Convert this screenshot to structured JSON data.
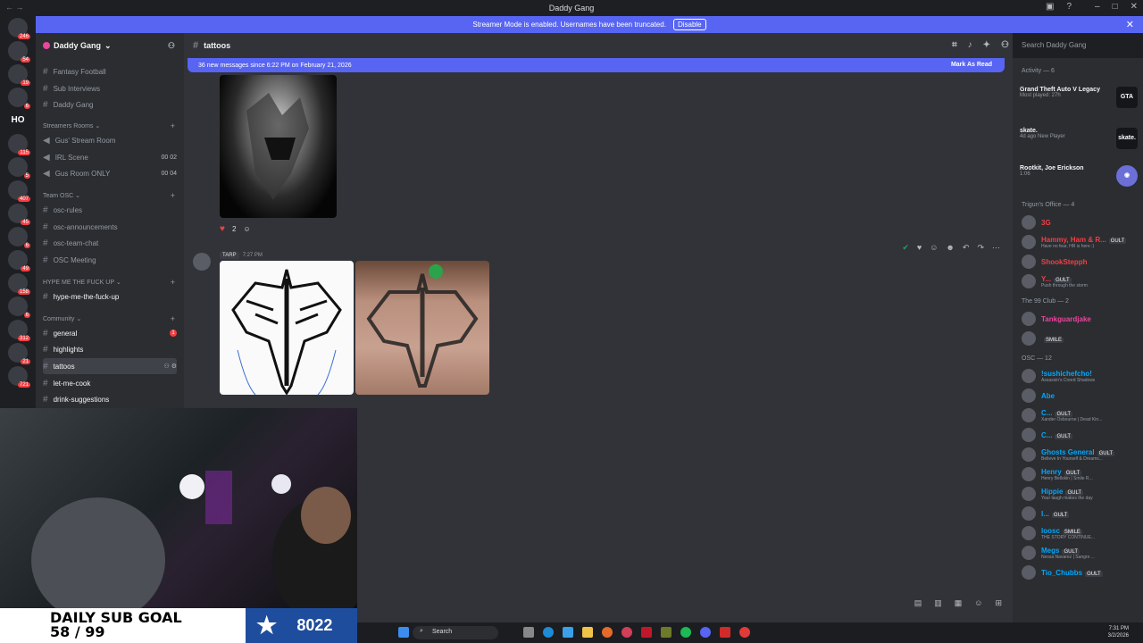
{
  "window": {
    "title": "Daddy Gang"
  },
  "banner": {
    "text": "Streamer Mode is enabled. Usernames have been truncated.",
    "button": "Disable"
  },
  "guilds": [
    {
      "badge": "246"
    },
    {
      "badge": "54"
    },
    {
      "badge": "19"
    },
    {
      "badge": "6"
    },
    {
      "label": "HO"
    },
    {
      "badge": "115"
    },
    {
      "badge": "5"
    },
    {
      "badge": "407"
    },
    {
      "badge": "45"
    },
    {
      "badge": "6"
    },
    {
      "badge": "49"
    },
    {
      "badge": "158"
    },
    {
      "badge": "6"
    },
    {
      "badge": "312"
    },
    {
      "badge": "21"
    },
    {
      "badge": "721"
    }
  ],
  "server": {
    "name": "Daddy Gang",
    "channels_top": [
      "Fantasy Football",
      "Sub Interviews",
      "Daddy Gang"
    ],
    "streamers": {
      "category": "Streamers Rooms",
      "items": [
        {
          "name": "Gus' Stream Room",
          "count": ""
        },
        {
          "name": "IRL Scene",
          "count": "00  02"
        },
        {
          "name": "Gus Room ONLY",
          "count": "00  04"
        }
      ]
    },
    "team": {
      "category": "Team OSC",
      "items": [
        "osc-rules",
        "osc-announcements",
        "osc-team-chat",
        "OSC Meeting"
      ]
    },
    "hype": {
      "category": "HYPE ME THE FUCK UP",
      "items": [
        "hype-me-the-fuck-up"
      ]
    },
    "community": {
      "category": "Community",
      "items": [
        {
          "name": "general",
          "unread": "1"
        },
        {
          "name": "highlights",
          "unread": ""
        },
        {
          "name": "tattoos",
          "unread": ""
        },
        {
          "name": "let-me-cook",
          "unread": ""
        },
        {
          "name": "drink-suggestions",
          "unread": ""
        }
      ]
    }
  },
  "channel": {
    "name": "tattoos",
    "search_placeholder": "Search Daddy Gang"
  },
  "new_messages": {
    "text": "36 new messages since 6:22 PM on February 21, 2026",
    "action": "Mark As Read"
  },
  "messages": [
    {
      "reaction_count": "2"
    },
    {
      "role": "TARP",
      "time": "7:27 PM"
    }
  ],
  "activity": {
    "header": "Activity — 6",
    "cards": [
      {
        "name": "Grand Theft Auto V Legacy",
        "sub": "Most played: 27h",
        "game": "GTA"
      },
      {
        "name": "skate.",
        "sub": "4d ago   New Player",
        "game": "skate."
      },
      {
        "name": "Rootkit, Joe Erickson",
        "sub": "1:06",
        "game": ""
      }
    ]
  },
  "members": {
    "groups": [
      {
        "title": "Trigun's Office — 4",
        "items": [
          {
            "name": "3G",
            "status": "",
            "tag": "",
            "color": "#f23f43"
          },
          {
            "name": "Hammy, Ham & R...",
            "status": "Have no fear, HR is here :)",
            "tag": "GULT",
            "color": "#f23f43"
          },
          {
            "name": "ShookStepph",
            "status": "",
            "tag": "",
            "color": "#f23f43"
          },
          {
            "name": "Y...",
            "status": "Push through the storm",
            "tag": "GULT",
            "color": "#f23f43"
          }
        ]
      },
      {
        "title": "The 99 Club — 2",
        "items": [
          {
            "name": "Tankguardjake",
            "status": "",
            "tag": "",
            "color": "#eb459e"
          },
          {
            "name": "",
            "status": "",
            "tag": "SMILE",
            "color": "#eb459e"
          }
        ]
      },
      {
        "title": "OSC — 12",
        "items": [
          {
            "name": "!sushichefcho!",
            "status": "Assassin's Creed Shadows",
            "tag": "",
            "color": "#00a8fc"
          },
          {
            "name": "Abe",
            "status": "",
            "tag": "",
            "color": "#00a8fc"
          },
          {
            "name": "C...",
            "status": "Xander Osbourne | Dead Kin...",
            "tag": "GULT",
            "color": "#00a8fc"
          },
          {
            "name": "C...",
            "status": "",
            "tag": "GULT",
            "color": "#00a8fc"
          },
          {
            "name": "Ghosts General",
            "status": "Believe In Yourself & Dreams...",
            "tag": "GULT",
            "color": "#00a8fc"
          },
          {
            "name": "Henry",
            "status": "Henry Bellskin | Smile R...",
            "tag": "GULT",
            "color": "#00a8fc"
          },
          {
            "name": "Hippie",
            "status": "Your laugh makes the day",
            "tag": "GULT",
            "color": "#00a8fc"
          },
          {
            "name": "I...",
            "status": "",
            "tag": "GULT",
            "color": "#00a8fc"
          },
          {
            "name": "loosc",
            "status": "THE STORY CONTINUE...",
            "tag": "SMILE",
            "color": "#00a8fc"
          },
          {
            "name": "Megs",
            "status": "Nessa Navarez | Sangre ...",
            "tag": "GULT",
            "color": "#00a8fc"
          },
          {
            "name": "Tio_Chubbs",
            "status": "",
            "tag": "GULT",
            "color": "#00a8fc"
          }
        ]
      }
    ]
  },
  "overlay": {
    "title": "DAILY SUB GOAL",
    "progress": "58 / 99",
    "count": "8022"
  },
  "taskbar": {
    "search": "Search",
    "time": "7:31 PM",
    "date": "3/2/2026"
  }
}
